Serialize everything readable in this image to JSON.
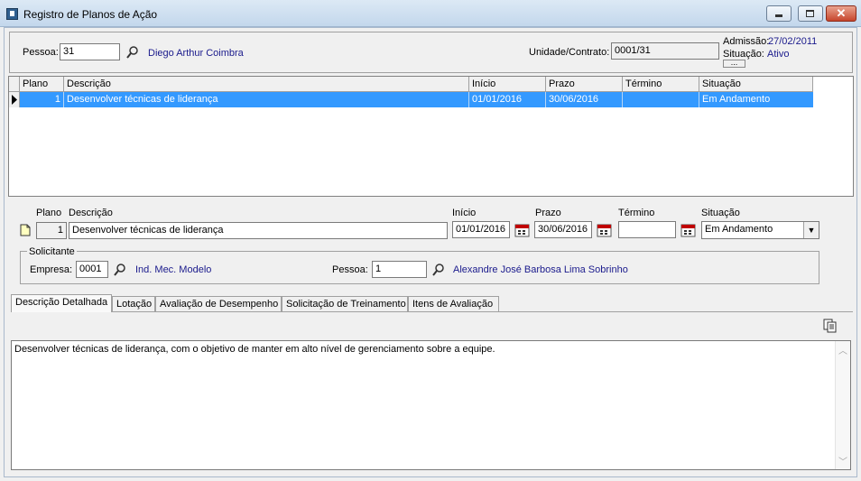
{
  "window": {
    "title": "Registro de Planos de Ação"
  },
  "header": {
    "pessoa_label": "Pessoa:",
    "pessoa_code": "31",
    "pessoa_name": "Diego Arthur Coimbra",
    "unidade_label": "Unidade/Contrato:",
    "unidade_value": "0001/31",
    "admissao_label": "Admissão:",
    "admissao_value": "27/02/2011",
    "situacao_label": "Situação:",
    "situacao_value": "Ativo",
    "more_button": "..."
  },
  "grid": {
    "columns": [
      "Plano",
      "Descrição",
      "Início",
      "Prazo",
      "Término",
      "Situação"
    ],
    "rows": [
      {
        "plano": "1",
        "descricao": "Desenvolver técnicas de liderança",
        "inicio": "01/01/2016",
        "prazo": "30/06/2016",
        "termino": "",
        "situacao": "Em Andamento"
      }
    ]
  },
  "detail": {
    "plano_label": "Plano",
    "plano_value": "1",
    "descricao_label": "Descrição",
    "descricao_value": "Desenvolver técnicas de liderança",
    "inicio_label": "Início",
    "inicio_value": "01/01/2016",
    "prazo_label": "Prazo",
    "prazo_value": "30/06/2016",
    "termino_label": "Término",
    "termino_value": "",
    "situacao_label": "Situação",
    "situacao_value": "Em Andamento"
  },
  "solicitante": {
    "title": "Solicitante",
    "empresa_label": "Empresa:",
    "empresa_code": "0001",
    "empresa_name": "Ind. Mec. Modelo",
    "pessoa_label": "Pessoa:",
    "pessoa_code": "1",
    "pessoa_name": "Alexandre José Barbosa Lima Sobrinho"
  },
  "tabs": [
    {
      "label": "Descrição Detalhada",
      "active": true
    },
    {
      "label": "Lotação",
      "active": false
    },
    {
      "label": "Avaliação de Desempenho",
      "active": false
    },
    {
      "label": "Solicitação de Treinamento",
      "active": false
    },
    {
      "label": "Itens de Avaliação",
      "active": false
    }
  ],
  "memo": {
    "text": "Desenvolver técnicas de liderança, com o objetivo de manter em alto nível de gerenciamento sobre a equipe."
  },
  "colors": {
    "selection": "#3399ff",
    "link": "#1a1a8c"
  },
  "icons": [
    "search-icon",
    "calendar-icon",
    "new-document-icon",
    "copy-icon",
    "minimize-icon",
    "maximize-icon",
    "close-icon"
  ]
}
